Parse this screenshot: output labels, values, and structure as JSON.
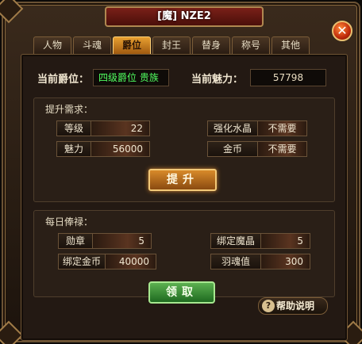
{
  "window": {
    "title": "[魔] NZE2",
    "close_glyph": "✕"
  },
  "tabs": [
    "人物",
    "斗魂",
    "爵位",
    "封王",
    "替身",
    "称号",
    "其他"
  ],
  "active_tab": "爵位",
  "rank": {
    "label": "当前爵位：",
    "value": "四级爵位 贵族"
  },
  "charm": {
    "label": "当前魅力：",
    "value": "57798"
  },
  "requirements": {
    "title": "提升需求：",
    "items": [
      {
        "label": "等级",
        "value": "22"
      },
      {
        "label": "魅力",
        "value": "56000"
      },
      {
        "label": "强化水晶",
        "value": "不需要"
      },
      {
        "label": "金币",
        "value": "不需要"
      }
    ],
    "upgrade_label": "提升"
  },
  "daily": {
    "title": "每日俸禄：",
    "items": [
      {
        "label": "勋章",
        "value": "5"
      },
      {
        "label": "绑定金币",
        "value": "40000"
      },
      {
        "label": "绑定魔晶",
        "value": "5"
      },
      {
        "label": "羽魂值",
        "value": "300"
      }
    ],
    "claim_label": "领取"
  },
  "help": {
    "icon_glyph": "?",
    "label": "帮助说明"
  },
  "colors": {
    "active_tab": "#e8a030",
    "rank_text": "#50ff60"
  }
}
